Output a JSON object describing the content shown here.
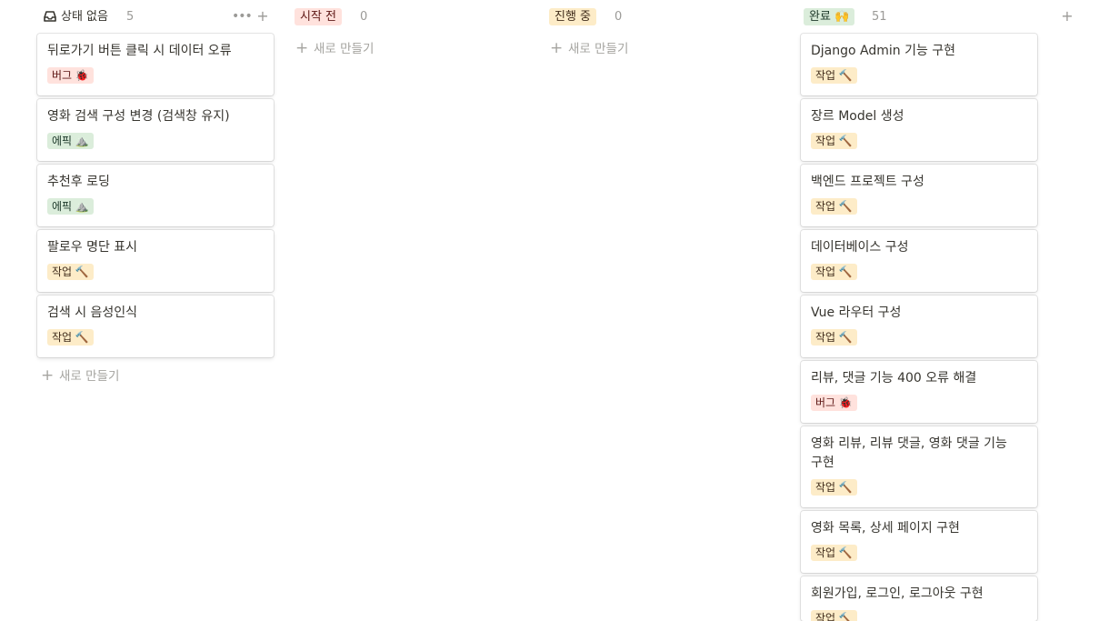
{
  "columns": {
    "no_status": {
      "label": "상태 없음",
      "count": "5",
      "more_icon": "ellipsis-icon",
      "add_icon": "plus-icon",
      "cards": [
        {
          "title": "뒤로가기 버튼 클릭 시 데이터 오류",
          "tag": "버그 🐞"
        },
        {
          "title": "영화 검색 구성 변경 (검색창 유지)",
          "tag": "에픽 ⛰️"
        },
        {
          "title": "추천후 로딩",
          "tag": "에픽 ⛰️"
        },
        {
          "title": "팔로우 명단 표시",
          "tag": "작업 🔨"
        },
        {
          "title": "검색 시 음성인식",
          "tag": "작업 🔨"
        }
      ],
      "new_label": "새로 만들기"
    },
    "not_started": {
      "label": "시작 전",
      "count": "0",
      "new_label": "새로 만들기",
      "color": "#ffe2dd"
    },
    "in_progress": {
      "label": "진행 중",
      "count": "0",
      "new_label": "새로 만들기",
      "color": "#fdecc8"
    },
    "done": {
      "label": "완료 🙌",
      "count": "51",
      "add_icon": "plus-icon",
      "color": "#dbeddb",
      "cards": [
        {
          "title": "Django Admin 기능 구현",
          "tag": "작업 🔨"
        },
        {
          "title": "장르 Model 생성",
          "tag": "작업 🔨"
        },
        {
          "title": "백엔드 프로젝트 구성",
          "tag": "작업 🔨"
        },
        {
          "title": "데이터베이스 구성",
          "tag": "작업 🔨"
        },
        {
          "title": "Vue 라우터 구성",
          "tag": "작업 🔨"
        },
        {
          "title": "리뷰, 댓글 기능 400 오류 해결",
          "tag": "버그 🐞"
        },
        {
          "title": "영화 리뷰, 리뷰 댓글, 영화 댓글 기능 구현",
          "tag": "작업 🔨"
        },
        {
          "title": "영화 목록, 상세 페이지 구현",
          "tag": "작업 🔨"
        },
        {
          "title": "회원가입, 로그인, 로그아웃 구현",
          "tag": "작업 🔨"
        }
      ]
    }
  },
  "add_column_icon": "plus-icon",
  "inbox_icon": "inbox-icon"
}
